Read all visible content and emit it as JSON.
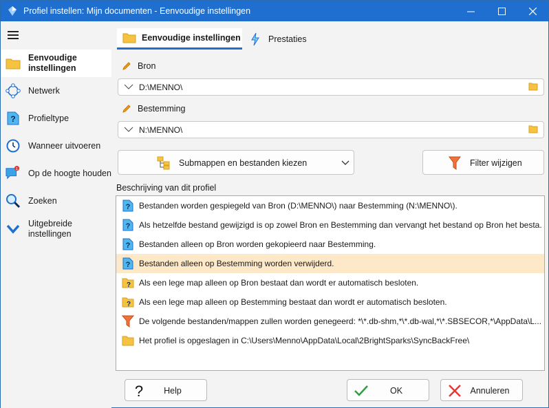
{
  "window": {
    "title": "Profiel instellen: Mijn documenten - Eenvoudige instellingen",
    "controls": {
      "minimize": "—",
      "maximize": "☐",
      "close": "✕"
    }
  },
  "sidebar": {
    "items": [
      {
        "label": "Eenvoudige\ninstellingen",
        "icon": "folder-icon"
      },
      {
        "label": "Netwerk",
        "icon": "network-icon"
      },
      {
        "label": "Profieltype",
        "icon": "question-doc-icon"
      },
      {
        "label": "Wanneer uitvoeren",
        "icon": "clock-icon"
      },
      {
        "label": "Op de hoogte houden",
        "icon": "notification-icon",
        "badge": "1"
      },
      {
        "label": "Zoeken",
        "icon": "search-icon"
      },
      {
        "label": "Uitgebreide\ninstellingen",
        "icon": "chevron-down-icon"
      }
    ]
  },
  "tabs": [
    {
      "label": "Eenvoudige instellingen",
      "icon": "folder-icon"
    },
    {
      "label": "Prestaties",
      "icon": "lightning-icon"
    }
  ],
  "source": {
    "label": "Bron",
    "value": "D:\\MENNO\\"
  },
  "destination": {
    "label": "Bestemming",
    "value": "N:\\MENNO\\"
  },
  "buttons": {
    "subfolders": "Submappen en bestanden kiezen",
    "filter": "Filter wijzigen"
  },
  "description": {
    "label": "Beschrijving van dit profiel",
    "rows": [
      {
        "text": "Bestanden worden gespiegeld van Bron (D:\\MENNO\\) naar Bestemming (N:\\MENNO\\).",
        "icon": "question-doc-icon"
      },
      {
        "text": "Als hetzelfde bestand gewijzigd is op zowel Bron en Bestemming dan vervangt het bestand op Bron het besta...",
        "icon": "question-doc-icon"
      },
      {
        "text": "Bestanden alleen op Bron worden gekopieerd naar Bestemming.",
        "icon": "question-doc-icon"
      },
      {
        "text": "Bestanden alleen op Bestemming worden verwijderd.",
        "icon": "question-doc-icon"
      },
      {
        "text": "Als een lege map alleen op Bron bestaat dan wordt er automatisch besloten.",
        "icon": "question-folder-icon"
      },
      {
        "text": "Als een lege map alleen op Bestemming bestaat dan wordt er automatisch besloten.",
        "icon": "question-folder-icon"
      },
      {
        "text": "De volgende bestanden/mappen zullen worden genegeerd: *\\*.db-shm,*\\*.db-wal,*\\*.SBSECOR,*\\AppData\\L...",
        "icon": "filter-icon"
      },
      {
        "text": "Het profiel is opgeslagen in C:\\Users\\Menno\\AppData\\Local\\2BrightSparks\\SyncBackFree\\",
        "icon": "folder-icon"
      }
    ]
  },
  "footer": {
    "help": "Help",
    "ok": "OK",
    "cancel": "Annuleren"
  },
  "colors": {
    "titlebar": "#1f6fd1",
    "accent": "#1f6fd1",
    "highlight_row": "#fde9c8",
    "folder": "#f5c242",
    "pencil": "#f39c12",
    "filter": "#f0743a"
  }
}
